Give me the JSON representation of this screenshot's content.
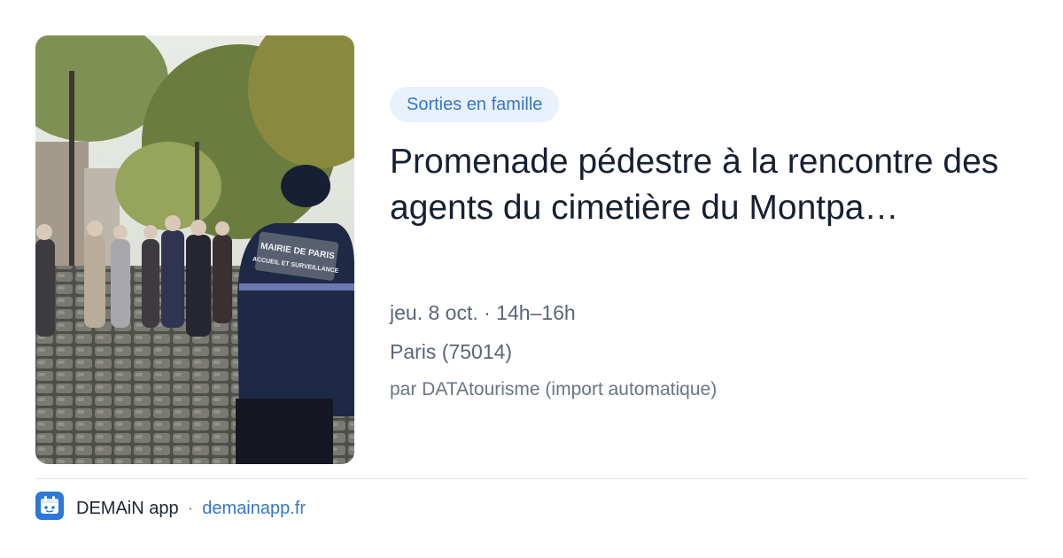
{
  "card": {
    "category": "Sorties en famille",
    "title": "Promenade pédestre à la rencontre des agents du cimetière du Montpa…",
    "when": "jeu. 8 oct. · 14h–16h",
    "place": "Paris (75014)",
    "source": "par DATAtourisme (import automatique)"
  },
  "photo": {
    "jacket_badge_line1": "MAIRIE DE PARIS",
    "jacket_badge_line2": "ACCUEIL ET SURVEILLANCE"
  },
  "footer": {
    "app_name": "DEMAiN app",
    "separator": "·",
    "site": "demainapp.fr"
  },
  "colors": {
    "accent": "#3777c9",
    "badge_bg": "#e8f1fc",
    "title": "#172033",
    "meta": "#59667a"
  }
}
